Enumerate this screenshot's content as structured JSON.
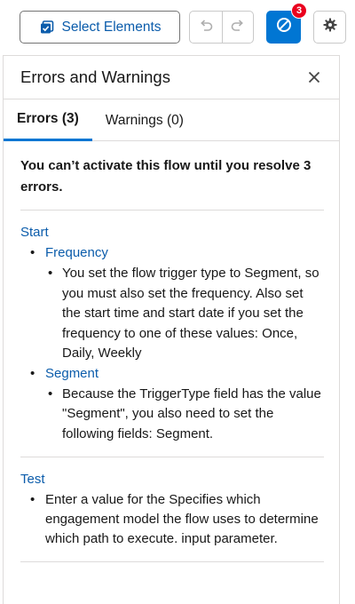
{
  "toolbar": {
    "select_label": "Select Elements",
    "error_count": "3"
  },
  "panel": {
    "title": "Errors and Warnings",
    "tabs": [
      {
        "label": "Errors (3)",
        "active": true
      },
      {
        "label": "Warnings (0)",
        "active": false
      }
    ],
    "summary": "You can’t activate this flow until you resolve 3 errors.",
    "sections": [
      {
        "title": "Start",
        "items": [
          {
            "label": "Frequency",
            "message": "You set the flow trigger type to Segment, so you must also set the frequency. Also set the start time and start date if you set the frequency to one of these values: Once, Daily, Weekly"
          },
          {
            "label": "Segment",
            "message": "Because the TriggerType field has the value \"Segment\", you also need to set the following fields: Segment."
          }
        ]
      },
      {
        "title": "Test",
        "message": "Enter a value for the Specifies which engagement model the flow uses to determine which path to execute. input parameter."
      }
    ]
  },
  "colors": {
    "accent": "#0176d3",
    "link": "#0b5cab",
    "badge": "#ea001e"
  },
  "icons": {
    "select": "checkbox-select-icon",
    "undo": "undo-icon",
    "redo": "redo-icon",
    "errors": "ban-icon",
    "settings": "gear-icon",
    "close": "close-icon"
  }
}
